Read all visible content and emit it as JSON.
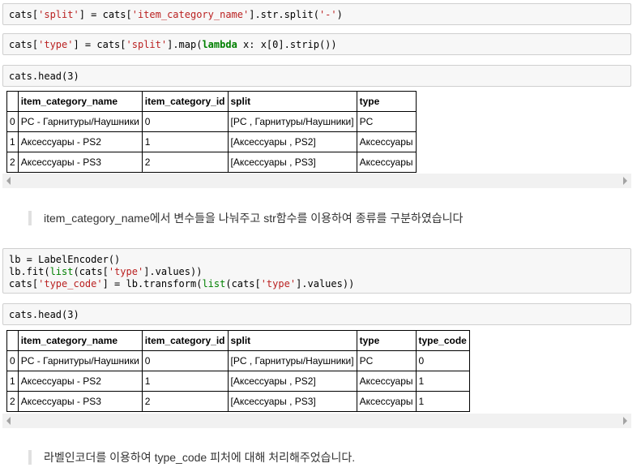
{
  "cells": {
    "c1": {
      "p1": "cats[",
      "s1": "'split'",
      "p2": "] = cats[",
      "s2": "'item_category_name'",
      "p3": "].str.split(",
      "s3": "'-'",
      "p4": ")"
    },
    "c2": {
      "p1": "cats[",
      "s1": "'type'",
      "p2": "] = cats[",
      "s2": "'split'",
      "p3": "].map(",
      "kw": "lambda",
      "p4": " x: x[0].strip())"
    },
    "c3": {
      "text": "cats.head(3)"
    },
    "c4": {
      "l1": "lb = LabelEncoder()",
      "l2a": "lb.fit(",
      "l2b": "list",
      "l2c": "(cats[",
      "l2d": "'type'",
      "l2e": "].values))",
      "l3a": "cats[",
      "l3b": "'type_code'",
      "l3c": "] = lb.transform(",
      "l3d": "list",
      "l3e": "(cats[",
      "l3f": "'type'",
      "l3g": "].values))"
    },
    "c5": {
      "text": "cats.head(3)"
    }
  },
  "table1": {
    "headers": [
      "",
      "item_category_name",
      "item_category_id",
      "split",
      "type"
    ],
    "rows": [
      [
        "0",
        "PC - Гарнитуры/Наушники",
        "0",
        "[PC , Гарнитуры/Наушники]",
        "PC"
      ],
      [
        "1",
        "Аксессуары - PS2",
        "1",
        "[Аксессуары , PS2]",
        "Аксессуары"
      ],
      [
        "2",
        "Аксессуары - PS3",
        "2",
        "[Аксессуары , PS3]",
        "Аксессуары"
      ]
    ]
  },
  "table2": {
    "headers": [
      "",
      "item_category_name",
      "item_category_id",
      "split",
      "type",
      "type_code"
    ],
    "rows": [
      [
        "0",
        "PC - Гарнитуры/Наушники",
        "0",
        "[PC , Гарнитуры/Наушники]",
        "PC",
        "0"
      ],
      [
        "1",
        "Аксессуары - PS2",
        "1",
        "[Аксессуары , PS2]",
        "Аксессуары",
        "1"
      ],
      [
        "2",
        "Аксессуары - PS3",
        "2",
        "[Аксессуары , PS3]",
        "Аксессуары",
        "1"
      ]
    ]
  },
  "markdown": {
    "md1": "item_category_name에서 변수들을 나눠주고 str함수를 이용하여 종류를 구분하였습니다",
    "md2": "라벨인코더를 이용하여 type_code 피처에 대해 처리해주었습니다."
  },
  "colors": {
    "string": "#ba2121",
    "keyword": "#008000",
    "cell_bg": "#f7f7f7"
  },
  "icons": [
    "scroll-left-arrow-icon",
    "scroll-right-arrow-icon"
  ]
}
